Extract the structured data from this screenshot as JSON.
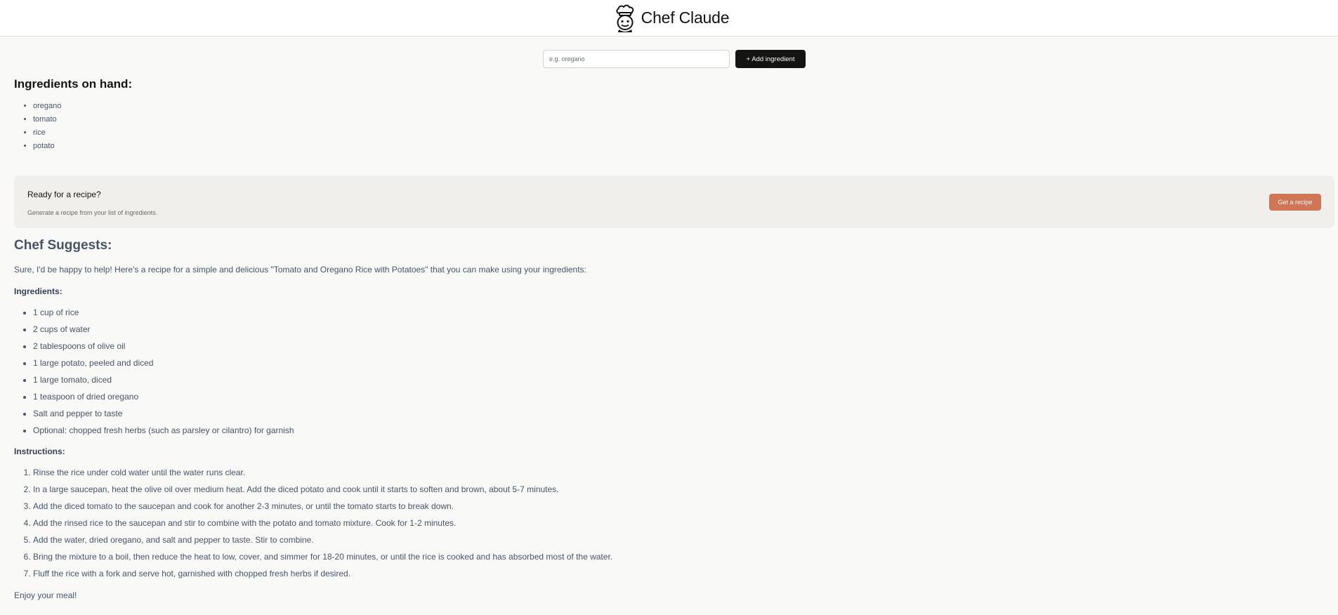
{
  "header": {
    "brand_name": "Chef Claude",
    "logo_icon": "chef-hat-face-icon"
  },
  "add_form": {
    "placeholder": "e.g. oregano",
    "button_label": "+ Add ingredient"
  },
  "ingredients": {
    "title": "Ingredients on hand:",
    "items": [
      "oregano",
      "tomato",
      "rice",
      "potato"
    ]
  },
  "cta": {
    "title": "Ready for a recipe?",
    "subtitle": "Generate a recipe from your list of ingredients.",
    "button_label": "Get a recipe"
  },
  "suggestion": {
    "title": "Chef Suggests:",
    "intro": "Sure, I'd be happy to help! Here's a recipe for a simple and delicious \"Tomato and Oregano Rice with Potatoes\" that you can make using your ingredients:",
    "ingredients_heading": "Ingredients:",
    "ingredients": [
      "1 cup of rice",
      "2 cups of water",
      "2 tablespoons of olive oil",
      "1 large potato, peeled and diced",
      "1 large tomato, diced",
      "1 teaspoon of dried oregano",
      "Salt and pepper to taste",
      "Optional: chopped fresh herbs (such as parsley or cilantro) for garnish"
    ],
    "instructions_heading": "Instructions:",
    "instructions": [
      "Rinse the rice under cold water until the water runs clear.",
      "In a large saucepan, heat the olive oil over medium heat. Add the diced potato and cook until it starts to soften and brown, about 5-7 minutes.",
      "Add the diced tomato to the saucepan and cook for another 2-3 minutes, or until the tomato starts to break down.",
      "Add the rinsed rice to the saucepan and stir to combine with the potato and tomato mixture. Cook for 1-2 minutes.",
      "Add the water, dried oregano, and salt and pepper to taste. Stir to combine.",
      "Bring the mixture to a boil, then reduce the heat to low, cover, and simmer for 18-20 minutes, or until the rice is cooked and has absorbed most of the water.",
      "Fluff the rice with a fork and serve hot, garnished with chopped fresh herbs if desired."
    ],
    "closing": "Enjoy your meal!"
  },
  "colors": {
    "accent": "#d17557",
    "dark_button": "#141413",
    "page_background": "#f9f9f7",
    "panel_background": "#f0efeb"
  }
}
